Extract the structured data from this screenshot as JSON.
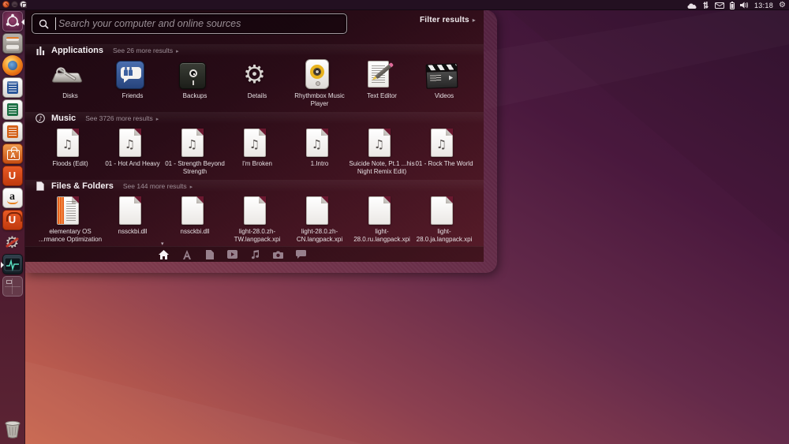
{
  "panel": {
    "time": "13:18",
    "window_controls": [
      "close",
      "minimize",
      "maximize"
    ],
    "indicator_icons": [
      "cloud-icon",
      "network-arrows-icon",
      "mail-icon",
      "battery-icon",
      "volume-icon",
      "session-gear-icon"
    ]
  },
  "search": {
    "placeholder": "Search your computer and online sources",
    "filter_label": "Filter results",
    "filter_arrow": "▸"
  },
  "sections": {
    "applications": {
      "title": "Applications",
      "see_more": "See 26 more results",
      "arrow": "▸",
      "items": [
        {
          "label": "Disks",
          "icon": "disks-icon"
        },
        {
          "label": "Friends",
          "icon": "friends-icon"
        },
        {
          "label": "Backups",
          "icon": "backups-icon"
        },
        {
          "label": "Details",
          "icon": "details-gear-icon"
        },
        {
          "label": "Rhythmbox Music Player",
          "icon": "rhythmbox-icon"
        },
        {
          "label": "Text Editor",
          "icon": "text-editor-icon"
        },
        {
          "label": "Videos",
          "icon": "videos-clapperboard-icon"
        }
      ]
    },
    "music": {
      "title": "Music",
      "see_more": "See 3726 more results",
      "arrow": "▸",
      "items": [
        {
          "label": "Floods (Edit)",
          "icon": "music-file-icon"
        },
        {
          "label": "01 - Hot And Heavy",
          "icon": "music-file-icon"
        },
        {
          "label": "01 - Strength Beyond Strength",
          "icon": "music-file-icon"
        },
        {
          "label": "I'm Broken",
          "icon": "music-file-icon"
        },
        {
          "label": "1.Intro",
          "icon": "music-file-icon"
        },
        {
          "label": "Suicide Note, Pt.1 ...his Night Remix Edit)",
          "icon": "music-file-icon"
        },
        {
          "label": "01 - Rock The World",
          "icon": "music-file-icon"
        }
      ]
    },
    "files": {
      "title": "Files & Folders",
      "see_more": "See 144 more results",
      "arrow": "▸",
      "items": [
        {
          "label": "elementary OS ...rmance Optimization",
          "icon": "document-file-icon"
        },
        {
          "label": "nssckbi.dll",
          "icon": "plain-file-icon"
        },
        {
          "label": "nssckbi.dll",
          "icon": "plain-file-icon"
        },
        {
          "label": "light-28.0.zh-TW.langpack.xpi",
          "icon": "plain-file-icon"
        },
        {
          "label": "light-28.0.zh-CN.langpack.xpi",
          "icon": "plain-file-icon"
        },
        {
          "label": "light-28.0.ru.langpack.xpi",
          "icon": "plain-file-icon"
        },
        {
          "label": "light-28.0.ja.langpack.xpi",
          "icon": "plain-file-icon"
        }
      ]
    }
  },
  "lens_bar": {
    "scroll_indicator": "▾",
    "lenses": [
      {
        "name": "home-lens",
        "active": true
      },
      {
        "name": "applications-lens",
        "active": false
      },
      {
        "name": "files-lens",
        "active": false
      },
      {
        "name": "videos-lens",
        "active": false
      },
      {
        "name": "music-lens",
        "active": false
      },
      {
        "name": "photos-lens",
        "active": false
      },
      {
        "name": "social-lens",
        "active": false
      }
    ]
  },
  "launcher": {
    "items": [
      "dash-home",
      "files-file-manager",
      "firefox",
      "libreoffice-writer",
      "libreoffice-calc",
      "libreoffice-impress",
      "ubuntu-software-center",
      "ubuntu-one",
      "amazon",
      "ubuntu-one-music",
      "system-settings",
      "system-monitor",
      "workspace-switcher",
      "trash"
    ],
    "amazon_letter": "a",
    "ubuntu_one_letter": "U",
    "softwarecenter_letter": "A"
  },
  "colors": {
    "accent_orange": "#dd4814",
    "panel_bg": "#231021",
    "dash_bg_dark": "#1c060f",
    "dash_bg_light": "#56263a",
    "wallpaper_top_right": "#331331",
    "wallpaper_bottom_left": "#cc6a50",
    "text_primary": "#f2edf0",
    "text_secondary": "#9e8e97"
  },
  "glyphs": {
    "music_note": "♫",
    "gear": "⚙"
  }
}
